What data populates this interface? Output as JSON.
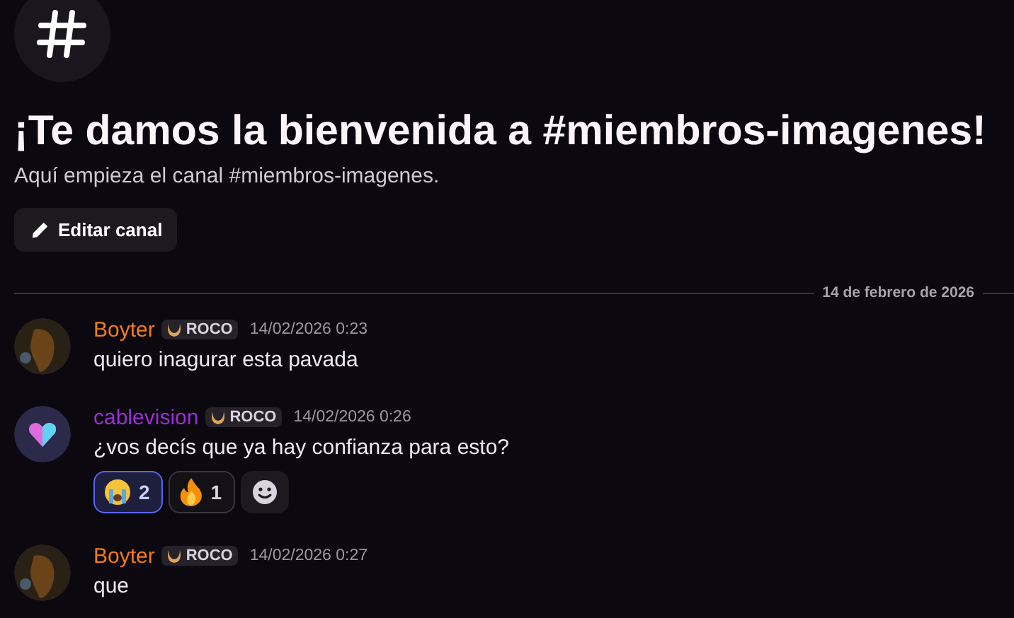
{
  "header": {
    "title": "¡Te damos la bienvenida a #miembros-imagenes!",
    "subtitle": "Aquí empieza el canal #miembros-imagenes.",
    "edit_button": "Editar canal"
  },
  "date_divider": "14 de febrero de 2026",
  "messages": [
    {
      "author": "Boyter",
      "color": "#f47b19",
      "tag": "ROCO",
      "time": "14/02/2026 0:23",
      "text": "quiero inagurar esta pavada",
      "avatar": {
        "kind": "horse"
      }
    },
    {
      "author": "cablevision",
      "color": "#9b2fd6",
      "tag": "ROCO",
      "time": "14/02/2026 0:26",
      "text": "¿vos decís que ya hay confianza para esto?",
      "avatar": {
        "kind": "heart"
      },
      "reactions": [
        {
          "kind": "crying",
          "count": "2",
          "selected": true
        },
        {
          "kind": "fire",
          "count": "1",
          "selected": false
        }
      ]
    },
    {
      "author": "Boyter",
      "color": "#f47b19",
      "tag": "ROCO",
      "time": "14/02/2026 0:27",
      "text": "que",
      "avatar": {
        "kind": "horse"
      }
    }
  ]
}
